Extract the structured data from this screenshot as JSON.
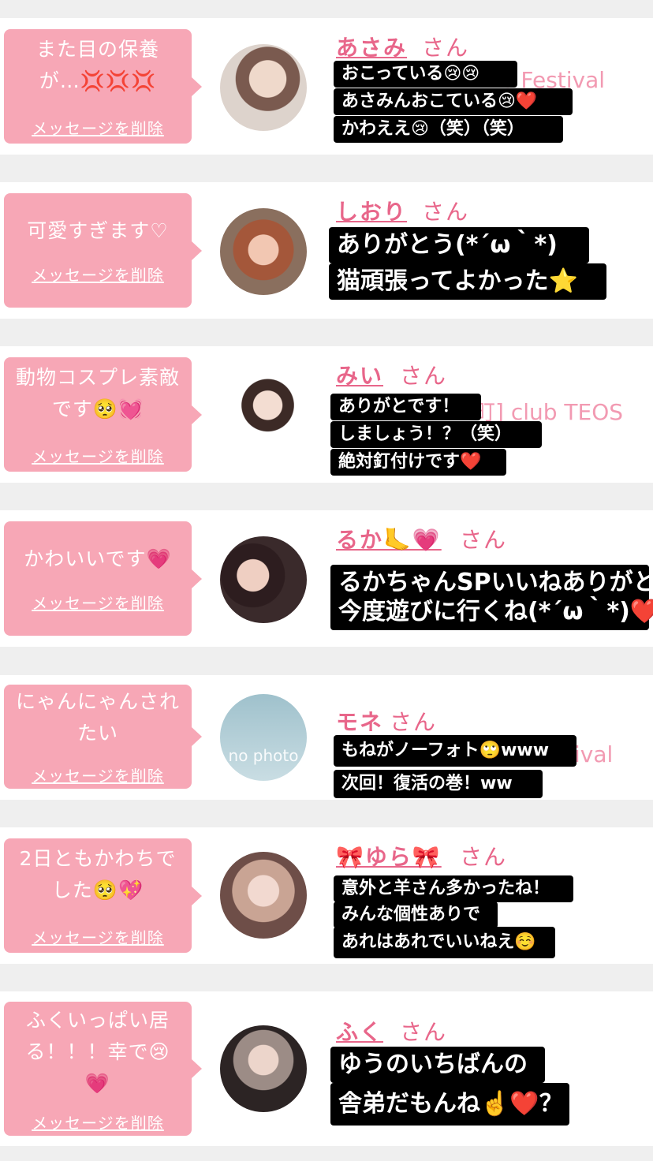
{
  "delete_label": "メッセージを削除",
  "san_label": "さん",
  "cards": [
    {
      "bubble": [
        "また目の保養",
        "が…💢💢💢"
      ],
      "name": "あさみ",
      "bg_text": "r Festival",
      "overlay": [
        "おこっている😢😢",
        "あさみんおこている😢❤️",
        "かわええ😢（笑）（笑）"
      ]
    },
    {
      "bubble": [
        "可愛すぎます♡"
      ],
      "name": "しおり",
      "bg_text": "",
      "overlay": [
        "ありがとう(*´ω｀*)",
        "猫頑張ってよかった⭐"
      ]
    },
    {
      "bubble": [
        "動物コスプレ素敵",
        "です🥺💓"
      ],
      "name": "みい",
      "bg_text": "町] club TEOS",
      "overlay": [
        "ありがとです！",
        "しましょう！？（笑）",
        "絶対釘付けです❤️"
      ]
    },
    {
      "bubble": [
        "かわいいです💗"
      ],
      "name": "るか🦶💗",
      "bg_text": "",
      "overlay": [
        "るかちゃんSPいいねありがと",
        "今度遊びに行くね(*´ω｀*)❤️"
      ]
    },
    {
      "bubble": [
        "にゃんにゃんされ",
        "たい"
      ],
      "name": "モネ",
      "bg_text": "ival",
      "avatar_text": "no photo",
      "overlay": [
        "もねがノーフォト🙄www",
        "次回！復活の巻！ww"
      ]
    },
    {
      "bubble": [
        "2日ともかわちで",
        "した🥺💖"
      ],
      "name": "🎀ゆら🎀",
      "bg_text": "",
      "overlay": [
        "意外と羊さん多かったね！",
        "みんな個性ありで",
        "あれはあれでいいねえ☺️"
      ]
    },
    {
      "bubble": [
        "ふくいっぱい居",
        "る！！！幸で😢",
        "💗"
      ],
      "name": "ふく",
      "bg_text": "",
      "overlay": [
        "ゆうのいちばんの",
        "舎弟だもんね☝️❤️？"
      ]
    }
  ]
}
